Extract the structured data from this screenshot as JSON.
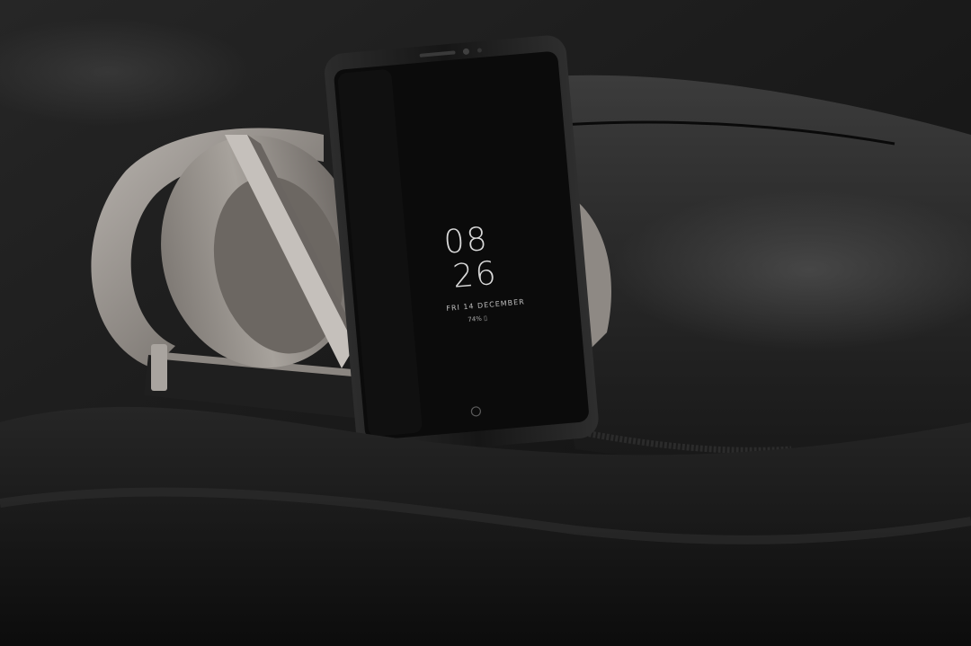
{
  "photo": {
    "subject": "smartphone resting in folded headphones on dark leather",
    "palette": {
      "background": "#111111",
      "leather_highlight": "#4a4a4a",
      "headphone_gray": "#9a948f",
      "phone_body": "#1a1a1a",
      "screen": "#0b0b0b",
      "clock_text": "#d9d9d9"
    }
  },
  "phone_screen": {
    "hour": "08",
    "minute": "26",
    "date": "FRI 14 DECEMBER",
    "status": "74% ▯"
  }
}
